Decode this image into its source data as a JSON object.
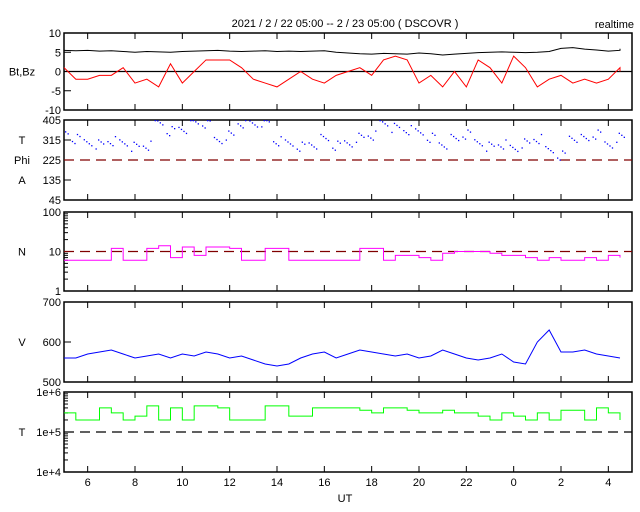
{
  "chart_data": {
    "type": "line",
    "title": "2021 / 2 / 22  05:00 --  2 / 23  05:00 ( DSCOVR )",
    "badge": "realtime",
    "xlabel": "UT",
    "x_range_hours": [
      0,
      24
    ],
    "x_ticks": [
      {
        "hour": 1,
        "label": "6"
      },
      {
        "hour": 3,
        "label": "8"
      },
      {
        "hour": 5,
        "label": "10"
      },
      {
        "hour": 7,
        "label": "12"
      },
      {
        "hour": 9,
        "label": "14"
      },
      {
        "hour": 11,
        "label": "16"
      },
      {
        "hour": 13,
        "label": "18"
      },
      {
        "hour": 15,
        "label": "20"
      },
      {
        "hour": 17,
        "label": "22"
      },
      {
        "hour": 19,
        "label": "0"
      },
      {
        "hour": 21,
        "label": "2"
      },
      {
        "hour": 23,
        "label": "4"
      }
    ],
    "panels": [
      {
        "id": "bt-bz",
        "ylabels": [
          "Bt,Bz"
        ],
        "scale": "linear",
        "ylim": [
          -10,
          10
        ],
        "yticks": [
          {
            "v": 10,
            "label": "10"
          },
          {
            "v": 5,
            "label": "5"
          },
          {
            "v": 0,
            "label": "0"
          },
          {
            "v": -5,
            "label": "-5"
          },
          {
            "v": -10,
            "label": "-10"
          }
        ],
        "ref": {
          "value": 0,
          "style": "solid",
          "color": "#000000"
        },
        "series": [
          {
            "name": "Bt",
            "color": "#000000",
            "mode": "line",
            "values": [
              5.5,
              5.4,
              5.5,
              5.3,
              5.4,
              5.2,
              5.0,
              5.2,
              5.1,
              5.0,
              5.2,
              5.3,
              5.4,
              5.5,
              5.3,
              5.2,
              5.3,
              5.4,
              5.2,
              5.3,
              5.2,
              5.3,
              5.4,
              5.0,
              4.8,
              4.6,
              4.5,
              4.7,
              4.6,
              4.5,
              4.8,
              4.6,
              4.3,
              4.5,
              4.7,
              4.9,
              5.0,
              5.1,
              5.0,
              4.9,
              5.0,
              5.2,
              6.0,
              6.2,
              5.8,
              5.6,
              5.3,
              5.5,
              5.9
            ]
          },
          {
            "name": "Bz",
            "color": "#ff0000",
            "mode": "line",
            "values": [
              1,
              -2,
              -2,
              -1,
              -1,
              1,
              -3,
              -2,
              -4,
              2,
              -3,
              0,
              3,
              3,
              3,
              1,
              -2,
              -3,
              -4,
              -2,
              0,
              -2,
              -3,
              -1,
              0,
              1,
              -1,
              3,
              4,
              3,
              -3,
              -1,
              -4,
              0,
              -4,
              3,
              1,
              -3,
              4,
              1,
              -4,
              -2,
              -1,
              -3,
              -2,
              -3,
              -2,
              1,
              0
            ]
          }
        ]
      },
      {
        "id": "phi",
        "ylabels": [
          "T",
          "Phi",
          "A"
        ],
        "scale": "linear",
        "ylim": [
          45,
          405
        ],
        "yticks": [
          {
            "v": 405,
            "label": "405"
          },
          {
            "v": 315,
            "label": "315"
          },
          {
            "v": 225,
            "label": "225"
          },
          {
            "v": 135,
            "label": "135"
          },
          {
            "v": 45,
            "label": "45"
          }
        ],
        "ref": {
          "value": 225,
          "style": "dashed",
          "color": "#800000"
        },
        "series": [
          {
            "name": "Phi",
            "color": "#0000ff",
            "mode": "dots",
            "values": [
              350,
              320,
              310,
              300,
              315,
              305,
              285,
              290,
              395,
              360,
              370,
              395,
              390,
              320,
              340,
              395,
              390,
              395,
              310,
              300,
              290,
              300,
              320,
              290,
              305,
              330,
              340,
              395,
              370,
              360,
              350,
              330,
              300,
              320,
              340,
              310,
              290,
              300,
              280,
              300,
              320,
              270,
              250,
              330,
              320,
              340,
              300,
              330,
              330
            ]
          }
        ]
      },
      {
        "id": "density",
        "ylabels": [
          "N"
        ],
        "scale": "log",
        "ylim": [
          1,
          100
        ],
        "yticks": [
          {
            "v": 100,
            "label": "100"
          },
          {
            "v": 10,
            "label": "10"
          },
          {
            "v": 1,
            "label": "1"
          }
        ],
        "ref": {
          "value": 10,
          "style": "dashed",
          "color": "#800000"
        },
        "series": [
          {
            "name": "N",
            "color": "#ff00ff",
            "mode": "step",
            "values": [
              6,
              6,
              6,
              6,
              12,
              6,
              6,
              12,
              14,
              7,
              13,
              8,
              13,
              13,
              12,
              6,
              6,
              12,
              12,
              6,
              6,
              6,
              6,
              6,
              6,
              12,
              12,
              6,
              8,
              8,
              7,
              6,
              9,
              10,
              10,
              10,
              9,
              8,
              8,
              7,
              6,
              7,
              6,
              6,
              7,
              6,
              8,
              7,
              8
            ]
          }
        ]
      },
      {
        "id": "speed",
        "ylabels": [
          "V"
        ],
        "scale": "linear",
        "ylim": [
          500,
          700
        ],
        "yticks": [
          {
            "v": 700,
            "label": "700"
          },
          {
            "v": 600,
            "label": "600"
          },
          {
            "v": 500,
            "label": "500"
          }
        ],
        "ref": null,
        "series": [
          {
            "name": "V",
            "color": "#0000ff",
            "mode": "line",
            "values": [
              560,
              560,
              570,
              575,
              580,
              570,
              560,
              565,
              570,
              560,
              570,
              565,
              575,
              570,
              560,
              565,
              555,
              545,
              540,
              545,
              560,
              570,
              575,
              560,
              570,
              580,
              575,
              570,
              565,
              570,
              560,
              565,
              580,
              570,
              560,
              555,
              560,
              570,
              550,
              545,
              600,
              630,
              575,
              575,
              580,
              570,
              565,
              560,
              560
            ]
          }
        ]
      },
      {
        "id": "temperature",
        "ylabels": [
          "T"
        ],
        "scale": "log",
        "ylim": [
          10000,
          1000000
        ],
        "yticks": [
          {
            "v": 1000000,
            "label": "1e+6"
          },
          {
            "v": 100000,
            "label": "1e+5"
          },
          {
            "v": 10000,
            "label": "1e+4"
          }
        ],
        "ref": {
          "value": 100000,
          "style": "dashed",
          "color": "#000000"
        },
        "series": [
          {
            "name": "T",
            "color": "#00ff00",
            "mode": "step",
            "values": [
              300000,
              200000,
              200000,
              400000,
              300000,
              200000,
              250000,
              450000,
              200000,
              400000,
              200000,
              450000,
              450000,
              400000,
              200000,
              200000,
              200000,
              450000,
              450000,
              250000,
              250000,
              400000,
              400000,
              400000,
              400000,
              350000,
              300000,
              400000,
              400000,
              350000,
              300000,
              300000,
              350000,
              300000,
              300000,
              250000,
              200000,
              300000,
              250000,
              200000,
              300000,
              200000,
              350000,
              350000,
              200000,
              400000,
              300000,
              200000,
              250000
            ]
          }
        ]
      }
    ]
  }
}
